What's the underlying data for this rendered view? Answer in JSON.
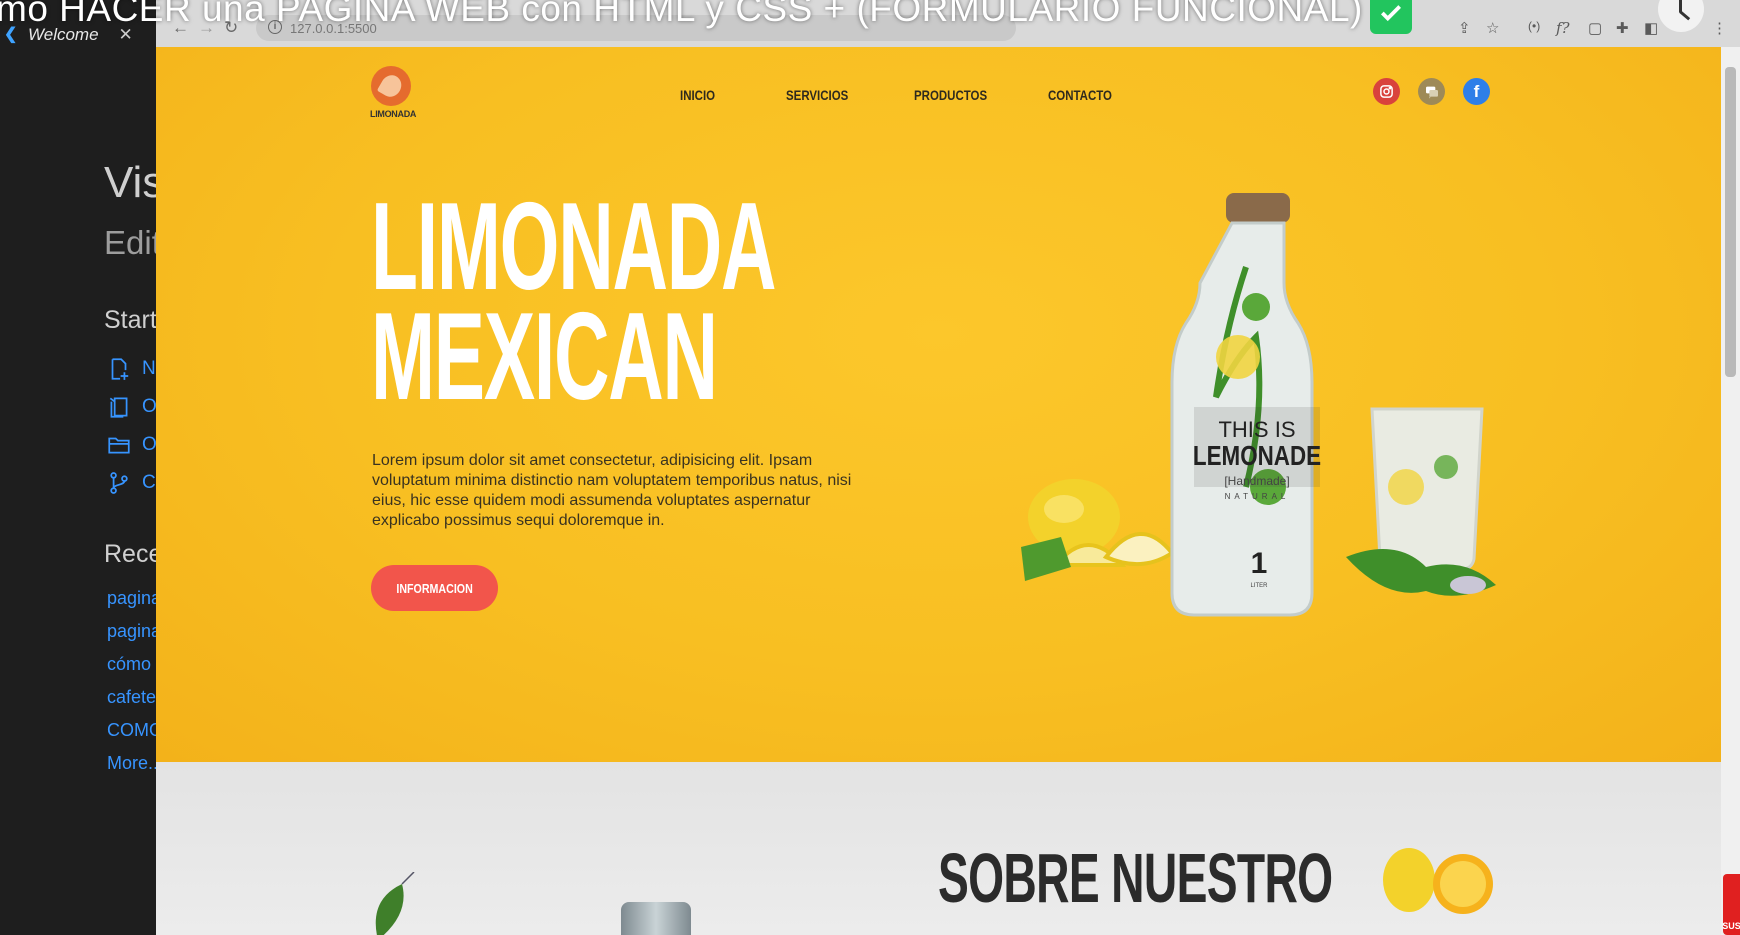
{
  "video": {
    "title": "mo HACER una PAGINA WEB con HTML y CSS + (FORMULARIO FUNCIONAL)"
  },
  "vscode": {
    "tab_label": "Welcome",
    "title": "Vis",
    "subtitle": "Edit",
    "start_heading": "Start",
    "start_items": [
      {
        "icon": "new-file-icon",
        "label": "N"
      },
      {
        "icon": "open-file-icon",
        "label": "O"
      },
      {
        "icon": "open-folder-icon",
        "label": "O"
      },
      {
        "icon": "git-branch-icon",
        "label": "C"
      }
    ],
    "recent_heading": "Rece",
    "recent_items": [
      "pagina",
      "pagina",
      "cómo",
      "cafete",
      "COMO",
      "More..."
    ]
  },
  "browser": {
    "url": "127.0.0.1:5500"
  },
  "site": {
    "logo_text": "LIMONADA",
    "nav": [
      "INICIO",
      "SERVICIOS",
      "PRODUCTOS",
      "CONTACTO"
    ],
    "social": [
      "instagram-icon",
      "messenger-icon",
      "facebook-icon"
    ],
    "hero": {
      "title_line1": "LIMONADA",
      "title_line2": "MEXICAN",
      "text": "Lorem ipsum dolor sit amet consectetur, adipisicing elit. Ipsam voluptatum minima distinctio nam voluptatem temporibus natus, nisi eius, hic esse quidem modi assumenda voluptates aspernatur explicabo possimus sequi doloremque in.",
      "button": "INFORMACION"
    },
    "product_label": {
      "line1": "THIS IS",
      "line2": "LEMONADE",
      "line3": "[Handmade]",
      "line4": "NATURAL",
      "volume": "1",
      "unit": "LITER"
    },
    "section_two_title": "SOBRE NUESTRO"
  },
  "colors": {
    "hero_bg": "#f8bf22",
    "button": "#f2554b",
    "link": "#3794ff"
  }
}
